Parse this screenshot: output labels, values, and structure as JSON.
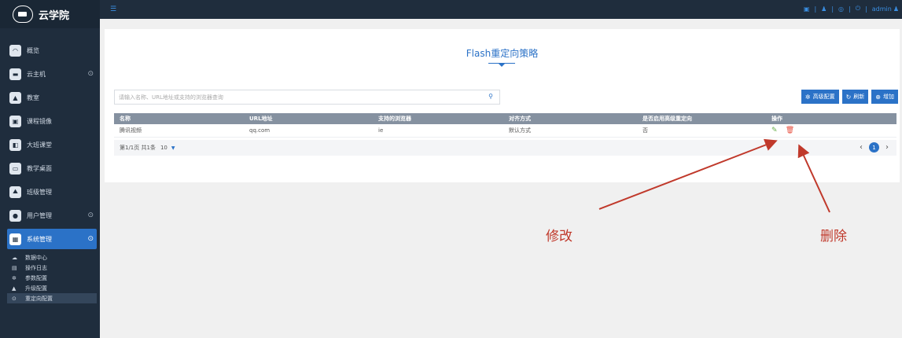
{
  "app": {
    "logo_text": "云学院"
  },
  "sidebar": {
    "items": [
      {
        "label": "概览",
        "icon": "dashboard-icon"
      },
      {
        "label": "云主机",
        "icon": "monitor-icon",
        "expandable": true
      },
      {
        "label": "教室",
        "icon": "classroom-icon"
      },
      {
        "label": "课程镜像",
        "icon": "image-icon"
      },
      {
        "label": "大班课堂",
        "icon": "presentation-icon"
      },
      {
        "label": "教学桌面",
        "icon": "desktop-icon"
      },
      {
        "label": "班级管理",
        "icon": "mountain-icon"
      },
      {
        "label": "用户管理",
        "icon": "user-icon",
        "expandable": true
      },
      {
        "label": "系统管理",
        "icon": "settings-icon",
        "expandable": true,
        "active": true
      }
    ],
    "submenu": [
      {
        "label": "数据中心",
        "icon": "cloud-icon"
      },
      {
        "label": "操作日志",
        "icon": "document-icon"
      },
      {
        "label": "参数配置",
        "icon": "gear-icon"
      },
      {
        "label": "升级配置",
        "icon": "upgrade-icon"
      },
      {
        "label": "重定向配置",
        "icon": "redirect-icon",
        "selected": true
      }
    ]
  },
  "topbar": {
    "user": "admin"
  },
  "main": {
    "title": "Flash重定向策略",
    "search_placeholder": "请输入名称、URL地址或支持的浏览器查询",
    "buttons": {
      "advanced": "高级配置",
      "refresh": "刷新",
      "add": "增加"
    },
    "table": {
      "headers": [
        "名称",
        "URL地址",
        "支持的浏览器",
        "对齐方式",
        "是否启用高级重定向",
        "操作"
      ],
      "rows": [
        {
          "name": "腾讯视频",
          "url": "qq.com",
          "browser": "ie",
          "align": "默认方式",
          "advanced": "否"
        }
      ]
    },
    "pager": {
      "info": "第1/1页 共1条",
      "page_size": "10",
      "current_page": "1"
    }
  },
  "annotations": {
    "edit": "修改",
    "delete": "删除"
  },
  "colors": {
    "sidebar_bg": "#1f2d3d",
    "accent": "#2b72c7",
    "annotation": "#c0392b"
  }
}
